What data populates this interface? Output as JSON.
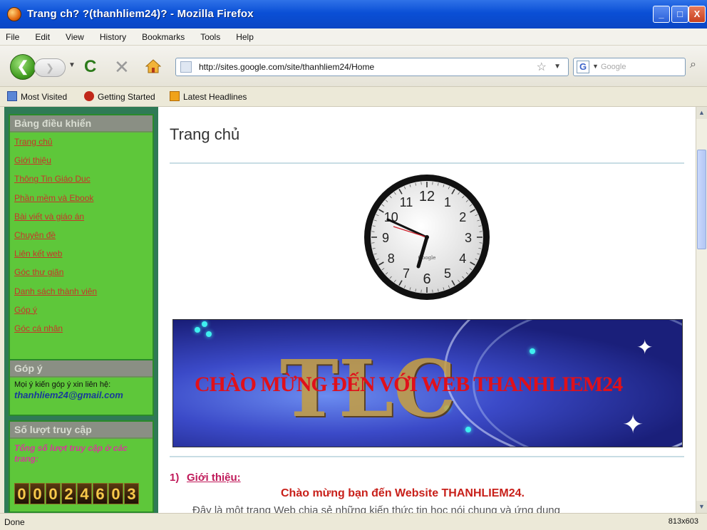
{
  "window": {
    "title": "Trang ch? ?(thanhliem24)? - Mozilla Firefox",
    "minimize": "_",
    "maximize": "□",
    "close": "X"
  },
  "menu": {
    "items": [
      "File",
      "Edit",
      "View",
      "History",
      "Bookmarks",
      "Tools",
      "Help"
    ]
  },
  "toolbar": {
    "back_icon": "back-arrow-icon",
    "forward_icon": "forward-arrow-icon",
    "reload_icon": "reload-icon",
    "stop_icon": "stop-icon",
    "home_icon": "home-icon",
    "url": "http://sites.google.com/site/thanhliem24/Home",
    "search_placeholder": "Google"
  },
  "bookmarks": {
    "items": [
      "Most Visited",
      "Getting Started",
      "Latest Headlines"
    ]
  },
  "sidebar": {
    "nav_heading": "Bảng điều khiển",
    "nav_items": [
      "Trang chủ",
      "Giới thiệu",
      "Thông Tin Giáo Dục",
      "Phần mềm và Ebook",
      "Bài viết và giáo án",
      "Chuyên đề",
      "Liên kết web",
      "Góc thư giãn",
      "Danh sách thành viên",
      "Góp ý",
      "Góc cá nhân"
    ],
    "feedback_heading": "Góp ý",
    "feedback_text": "Mọi ý kiến góp ý xin liên hệ:",
    "feedback_email": "thanhliem24@gmail.com",
    "visits_heading": "Số lượt truy cập",
    "visits_label": "Tổng số lượt truy cập ở các trang:",
    "visit_counter": "00024603"
  },
  "main": {
    "page_title": "Trang chủ",
    "clock_brand": "Google",
    "clock_numbers": [
      "12",
      "1",
      "2",
      "3",
      "4",
      "5",
      "6",
      "7",
      "8",
      "9",
      "10",
      "11"
    ],
    "banner_text": "CHÀO MỪNG ĐẾN VỚI WEB THANHLIEM24",
    "banner_logo": "TLC",
    "section_num": "1)",
    "section_title": "Giới thiệu:",
    "welcome_line": "Chào mừng bạn đến Website THANHLIEM24.",
    "intro_text": "Đây là một trang Web chia sẻ những kiến thức tin học nói chung và ứng dụng"
  },
  "status": {
    "text": "Done",
    "dims": "813x603"
  },
  "colors": {
    "titlebar": "#0a4fd6",
    "sidebar_bg": "#5ec73a",
    "link": "#c8342a",
    "heading_accent": "#c01a5a"
  }
}
